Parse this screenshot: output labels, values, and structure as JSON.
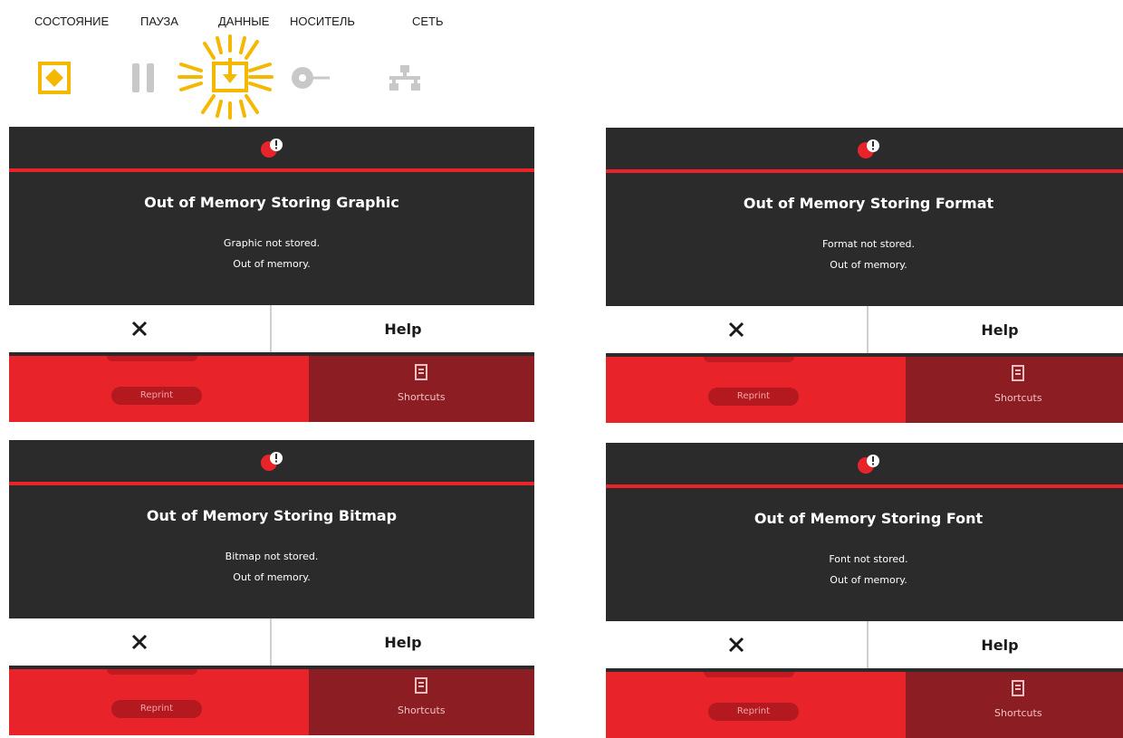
{
  "indicators": [
    {
      "label": "СОСТОЯНИЕ",
      "icon": "status-icon",
      "state": "on",
      "color": "#f5b800"
    },
    {
      "label": "ПАУЗА",
      "icon": "pause-icon",
      "state": "off",
      "color": "#c8c8c8"
    },
    {
      "label": "ДАННЫЕ",
      "icon": "data-icon",
      "state": "flashing",
      "color": "#f5b800"
    },
    {
      "label": "НОСИТЕЛЬ",
      "icon": "media-icon",
      "state": "off",
      "color": "#c8c8c8"
    },
    {
      "label": "СЕТЬ",
      "icon": "network-icon",
      "state": "off",
      "color": "#c8c8c8"
    }
  ],
  "screens": [
    {
      "title": "Out of Memory Storing Graphic",
      "line1": "Graphic not stored.",
      "line2": "Out of memory.",
      "help": "Help",
      "reprint": "Reprint",
      "shortcuts": "Shortcuts"
    },
    {
      "title": "Out of Memory Storing Format",
      "line1": "Format not stored.",
      "line2": "Out of memory.",
      "help": "Help",
      "reprint": "Reprint",
      "shortcuts": "Shortcuts"
    },
    {
      "title": "Out of Memory Storing Bitmap",
      "line1": "Bitmap not stored.",
      "line2": "Out of memory.",
      "help": "Help",
      "reprint": "Reprint",
      "shortcuts": "Shortcuts"
    },
    {
      "title": "Out of Memory Storing Font",
      "line1": "Font not stored.",
      "line2": "Out of memory.",
      "help": "Help",
      "reprint": "Reprint",
      "shortcuts": "Shortcuts"
    }
  ],
  "colors": {
    "screen_bg": "#2b2b2b",
    "accent_red": "#e8232a",
    "dark_red": "#8c1d22",
    "indicator_on": "#f5b800",
    "indicator_off": "#c8c8c8"
  }
}
